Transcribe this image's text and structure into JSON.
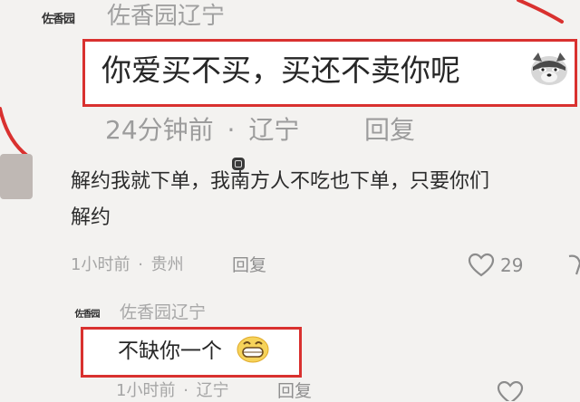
{
  "colors": {
    "highlight": "#d9312f",
    "meta_text": "#a3a3a3",
    "name_text": "#a0a0a0",
    "body_text": "#2b2b2b",
    "background": "#f3f2f0"
  },
  "top_comment": {
    "avatar_text": "佐香园",
    "username": "佐香园辽宁",
    "text": "你爱买不买，买还不卖你呢",
    "emoji_icon": "husky-dog-emoji-icon",
    "meta_time": "24分钟前",
    "meta_sep": "·",
    "meta_location": "辽宁",
    "reply_label": "回复"
  },
  "second_comment": {
    "text_line1": "解约我就下单，我南方人不吃也下单，只要你们",
    "text_line2": "解约",
    "meta_time": "1小时前",
    "meta_sep": "·",
    "meta_location": "贵州",
    "reply_label": "回复",
    "like_icon": "heart-icon",
    "like_count": "29"
  },
  "nested_reply": {
    "avatar_text": "佐香园",
    "username": "佐香园辽宁",
    "text": "不缺你一个",
    "emoji_icon": "grinning-face-emoji-icon",
    "meta_time": "1小时前",
    "meta_sep": "·",
    "meta_location": "辽宁",
    "reply_label": "回复"
  }
}
